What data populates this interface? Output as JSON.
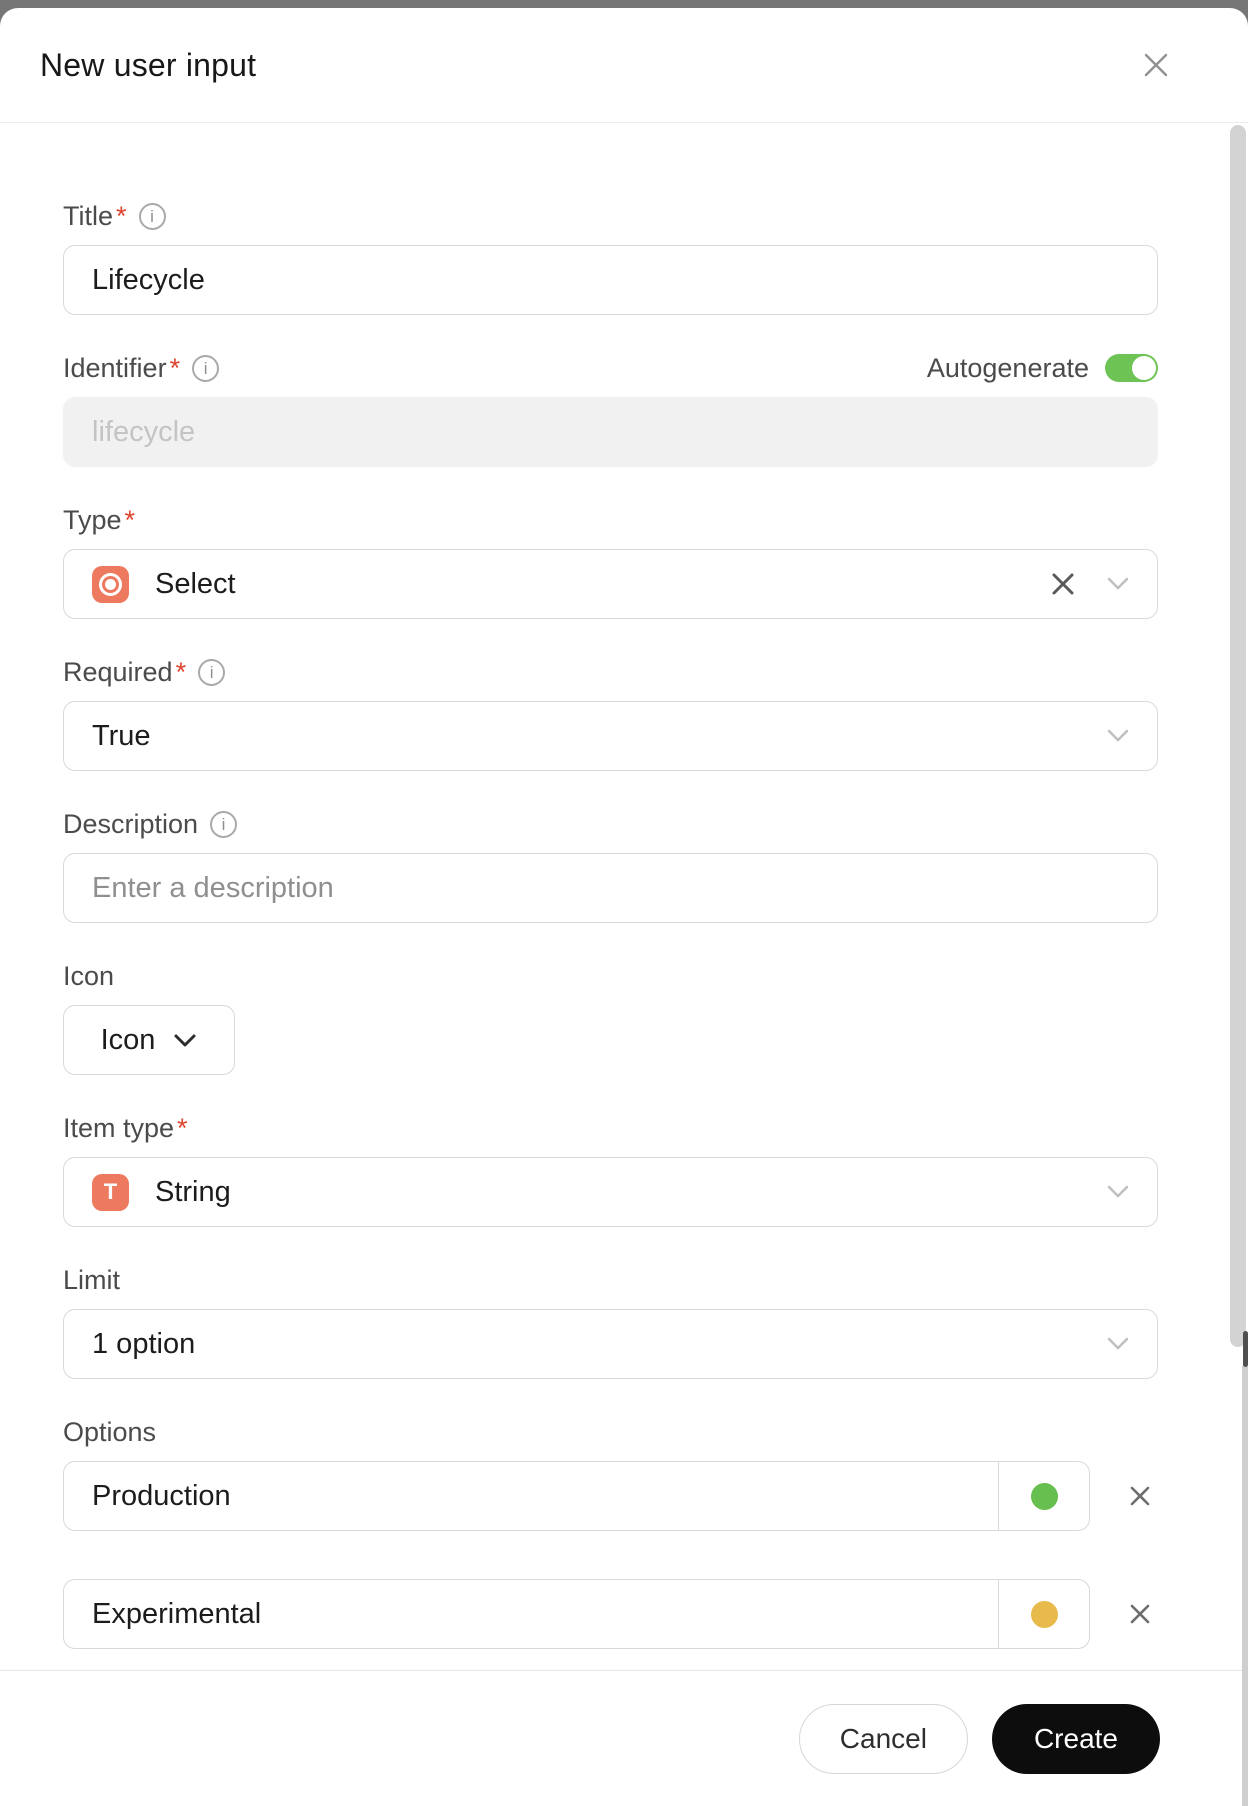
{
  "required_marker": "*",
  "header": {
    "title": "New user input"
  },
  "icons": {
    "info_glyph": "i"
  },
  "fields": {
    "title": {
      "label": "Title",
      "required": true,
      "has_info": true,
      "value": "Lifecycle"
    },
    "identifier": {
      "label": "Identifier",
      "required": true,
      "has_info": true,
      "autogenerate_label": "Autogenerate",
      "autogenerate_on": true,
      "placeholder": "lifecycle",
      "disabled": true
    },
    "type": {
      "label": "Type",
      "required": true,
      "value": "Select",
      "icon": "select-type-icon",
      "icon_color": "#ed7a5f",
      "clearable": true
    },
    "required": {
      "label": "Required",
      "required": true,
      "has_info": true,
      "value": "True"
    },
    "description": {
      "label": "Description",
      "has_info": true,
      "value": "",
      "placeholder": "Enter a description"
    },
    "icon": {
      "label": "Icon",
      "button_label": "Icon"
    },
    "item_type": {
      "label": "Item type",
      "required": true,
      "value": "String",
      "icon": "string-type-icon",
      "icon_letter": "T",
      "icon_color": "#ed7a5f"
    },
    "limit": {
      "label": "Limit",
      "value": "1 option"
    },
    "options": {
      "label": "Options",
      "items": [
        {
          "value": "Production",
          "color": "#66bf4e",
          "color_name": "green"
        },
        {
          "value": "Experimental",
          "color": "#e8ba4b",
          "color_name": "amber"
        }
      ]
    }
  },
  "footer": {
    "cancel_label": "Cancel",
    "create_label": "Create"
  },
  "colors": {
    "toggle_on": "#6dc454",
    "required_asterisk": "#e0432d",
    "create_button_bg": "#0d0d0d",
    "field_icon_bg": "#ed7a5f"
  }
}
